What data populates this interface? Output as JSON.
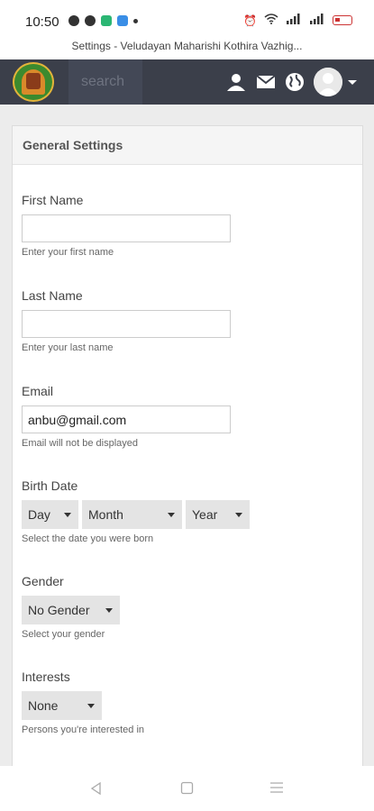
{
  "status": {
    "time": "10:50"
  },
  "browser": {
    "title": "Settings - Veludayan Maharishi Kothira Vazhig..."
  },
  "navbar": {
    "search_placeholder": "search",
    "icons": [
      "user-icon",
      "mail-icon",
      "globe-icon",
      "avatar",
      "chevron-down-icon"
    ]
  },
  "panel": {
    "title": "General Settings"
  },
  "form": {
    "first_name": {
      "label": "First Name",
      "value": "",
      "help": "Enter your first name"
    },
    "last_name": {
      "label": "Last Name",
      "value": "",
      "help": "Enter your last name"
    },
    "email": {
      "label": "Email",
      "value": "anbu@gmail.com",
      "help": "Email will not be displayed"
    },
    "birth_date": {
      "label": "Birth Date",
      "day": "Day",
      "month": "Month",
      "year": "Year",
      "help": "Select the date you were born"
    },
    "gender": {
      "label": "Gender",
      "value": "No Gender",
      "help": "Select your gender"
    },
    "interests": {
      "label": "Interests",
      "value": "None",
      "help": "Persons you're interested in"
    }
  },
  "colors": {
    "navbar": "#3b3f4a",
    "panel_header": "#f5f5f5",
    "select_bg": "#e4e4e4"
  }
}
